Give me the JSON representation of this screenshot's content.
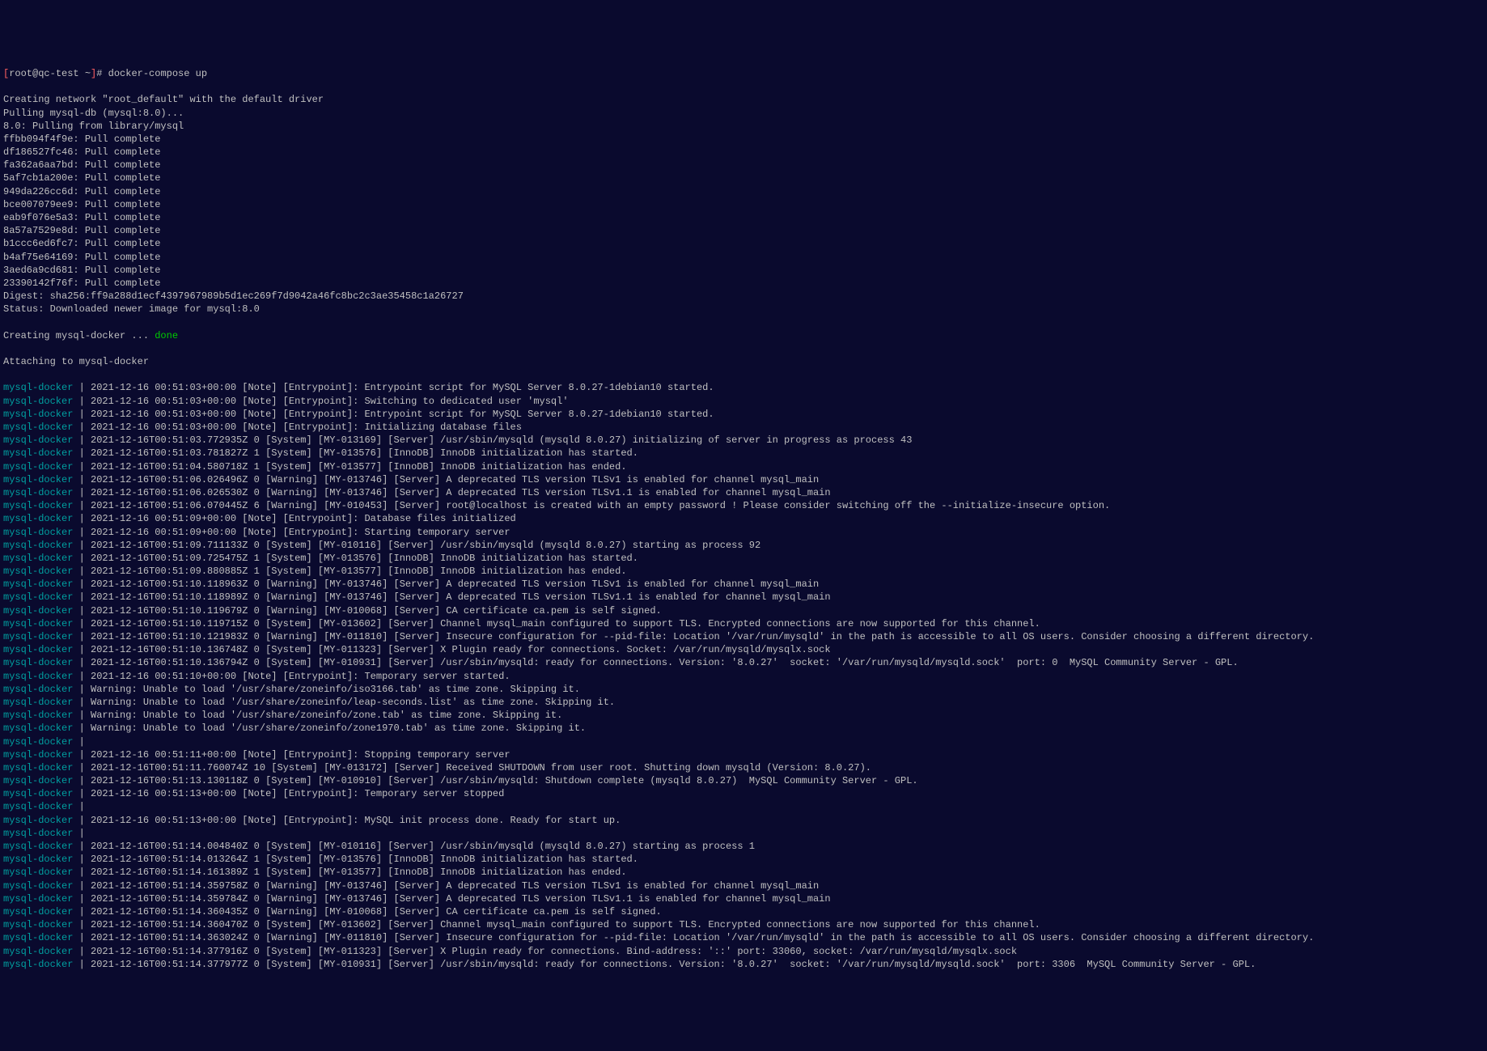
{
  "prompt": {
    "user": "root@qc-test",
    "path": "~",
    "command": "docker-compose up"
  },
  "setup_lines": [
    "Creating network \"root_default\" with the default driver",
    "Pulling mysql-db (mysql:8.0)...",
    "8.0: Pulling from library/mysql",
    "ffbb094f4f9e: Pull complete",
    "df186527fc46: Pull complete",
    "fa362a6aa7bd: Pull complete",
    "5af7cb1a200e: Pull complete",
    "949da226cc6d: Pull complete",
    "bce007079ee9: Pull complete",
    "eab9f076e5a3: Pull complete",
    "8a57a7529e8d: Pull complete",
    "b1ccc6ed6fc7: Pull complete",
    "b4af75e64169: Pull complete",
    "3aed6a9cd681: Pull complete",
    "23390142f76f: Pull complete",
    "Digest: sha256:ff9a288d1ecf4397967989b5d1ec269f7d9042a46fc8bc2c3ae35458c1a26727",
    "Status: Downloaded newer image for mysql:8.0"
  ],
  "creating_text": "Creating mysql-docker ... ",
  "done_text": "done",
  "attaching_text": "Attaching to mysql-docker",
  "container_name": "mysql-docker",
  "log_lines": [
    " 2021-12-16 00:51:03+00:00 [Note] [Entrypoint]: Entrypoint script for MySQL Server 8.0.27-1debian10 started.",
    " 2021-12-16 00:51:03+00:00 [Note] [Entrypoint]: Switching to dedicated user 'mysql'",
    " 2021-12-16 00:51:03+00:00 [Note] [Entrypoint]: Entrypoint script for MySQL Server 8.0.27-1debian10 started.",
    " 2021-12-16 00:51:03+00:00 [Note] [Entrypoint]: Initializing database files",
    " 2021-12-16T00:51:03.772935Z 0 [System] [MY-013169] [Server] /usr/sbin/mysqld (mysqld 8.0.27) initializing of server in progress as process 43",
    " 2021-12-16T00:51:03.781827Z 1 [System] [MY-013576] [InnoDB] InnoDB initialization has started.",
    " 2021-12-16T00:51:04.580718Z 1 [System] [MY-013577] [InnoDB] InnoDB initialization has ended.",
    " 2021-12-16T00:51:06.026496Z 0 [Warning] [MY-013746] [Server] A deprecated TLS version TLSv1 is enabled for channel mysql_main",
    " 2021-12-16T00:51:06.026530Z 0 [Warning] [MY-013746] [Server] A deprecated TLS version TLSv1.1 is enabled for channel mysql_main",
    " 2021-12-16T00:51:06.070445Z 6 [Warning] [MY-010453] [Server] root@localhost is created with an empty password ! Please consider switching off the --initialize-insecure option.",
    " 2021-12-16 00:51:09+00:00 [Note] [Entrypoint]: Database files initialized",
    " 2021-12-16 00:51:09+00:00 [Note] [Entrypoint]: Starting temporary server",
    " 2021-12-16T00:51:09.711133Z 0 [System] [MY-010116] [Server] /usr/sbin/mysqld (mysqld 8.0.27) starting as process 92",
    " 2021-12-16T00:51:09.725475Z 1 [System] [MY-013576] [InnoDB] InnoDB initialization has started.",
    " 2021-12-16T00:51:09.880885Z 1 [System] [MY-013577] [InnoDB] InnoDB initialization has ended.",
    " 2021-12-16T00:51:10.118963Z 0 [Warning] [MY-013746] [Server] A deprecated TLS version TLSv1 is enabled for channel mysql_main",
    " 2021-12-16T00:51:10.118989Z 0 [Warning] [MY-013746] [Server] A deprecated TLS version TLSv1.1 is enabled for channel mysql_main",
    " 2021-12-16T00:51:10.119679Z 0 [Warning] [MY-010068] [Server] CA certificate ca.pem is self signed.",
    " 2021-12-16T00:51:10.119715Z 0 [System] [MY-013602] [Server] Channel mysql_main configured to support TLS. Encrypted connections are now supported for this channel.",
    " 2021-12-16T00:51:10.121983Z 0 [Warning] [MY-011810] [Server] Insecure configuration for --pid-file: Location '/var/run/mysqld' in the path is accessible to all OS users. Consider choosing a different directory.",
    " 2021-12-16T00:51:10.136748Z 0 [System] [MY-011323] [Server] X Plugin ready for connections. Socket: /var/run/mysqld/mysqlx.sock",
    " 2021-12-16T00:51:10.136794Z 0 [System] [MY-010931] [Server] /usr/sbin/mysqld: ready for connections. Version: '8.0.27'  socket: '/var/run/mysqld/mysqld.sock'  port: 0  MySQL Community Server - GPL.",
    " 2021-12-16 00:51:10+00:00 [Note] [Entrypoint]: Temporary server started.",
    " Warning: Unable to load '/usr/share/zoneinfo/iso3166.tab' as time zone. Skipping it.",
    " Warning: Unable to load '/usr/share/zoneinfo/leap-seconds.list' as time zone. Skipping it.",
    " Warning: Unable to load '/usr/share/zoneinfo/zone.tab' as time zone. Skipping it.",
    " Warning: Unable to load '/usr/share/zoneinfo/zone1970.tab' as time zone. Skipping it.",
    "",
    " 2021-12-16 00:51:11+00:00 [Note] [Entrypoint]: Stopping temporary server",
    " 2021-12-16T00:51:11.760074Z 10 [System] [MY-013172] [Server] Received SHUTDOWN from user root. Shutting down mysqld (Version: 8.0.27).",
    " 2021-12-16T00:51:13.130118Z 0 [System] [MY-010910] [Server] /usr/sbin/mysqld: Shutdown complete (mysqld 8.0.27)  MySQL Community Server - GPL.",
    " 2021-12-16 00:51:13+00:00 [Note] [Entrypoint]: Temporary server stopped",
    "",
    " 2021-12-16 00:51:13+00:00 [Note] [Entrypoint]: MySQL init process done. Ready for start up.",
    "",
    " 2021-12-16T00:51:14.004840Z 0 [System] [MY-010116] [Server] /usr/sbin/mysqld (mysqld 8.0.27) starting as process 1",
    " 2021-12-16T00:51:14.013264Z 1 [System] [MY-013576] [InnoDB] InnoDB initialization has started.",
    " 2021-12-16T00:51:14.161389Z 1 [System] [MY-013577] [InnoDB] InnoDB initialization has ended.",
    " 2021-12-16T00:51:14.359758Z 0 [Warning] [MY-013746] [Server] A deprecated TLS version TLSv1 is enabled for channel mysql_main",
    " 2021-12-16T00:51:14.359784Z 0 [Warning] [MY-013746] [Server] A deprecated TLS version TLSv1.1 is enabled for channel mysql_main",
    " 2021-12-16T00:51:14.360435Z 0 [Warning] [MY-010068] [Server] CA certificate ca.pem is self signed.",
    " 2021-12-16T00:51:14.360470Z 0 [System] [MY-013602] [Server] Channel mysql_main configured to support TLS. Encrypted connections are now supported for this channel.",
    " 2021-12-16T00:51:14.363024Z 0 [Warning] [MY-011810] [Server] Insecure configuration for --pid-file: Location '/var/run/mysqld' in the path is accessible to all OS users. Consider choosing a different directory.",
    " 2021-12-16T00:51:14.377916Z 0 [System] [MY-011323] [Server] X Plugin ready for connections. Bind-address: '::' port: 33060, socket: /var/run/mysqld/mysqlx.sock",
    " 2021-12-16T00:51:14.377977Z 0 [System] [MY-010931] [Server] /usr/sbin/mysqld: ready for connections. Version: '8.0.27'  socket: '/var/run/mysqld/mysqld.sock'  port: 3306  MySQL Community Server - GPL."
  ]
}
